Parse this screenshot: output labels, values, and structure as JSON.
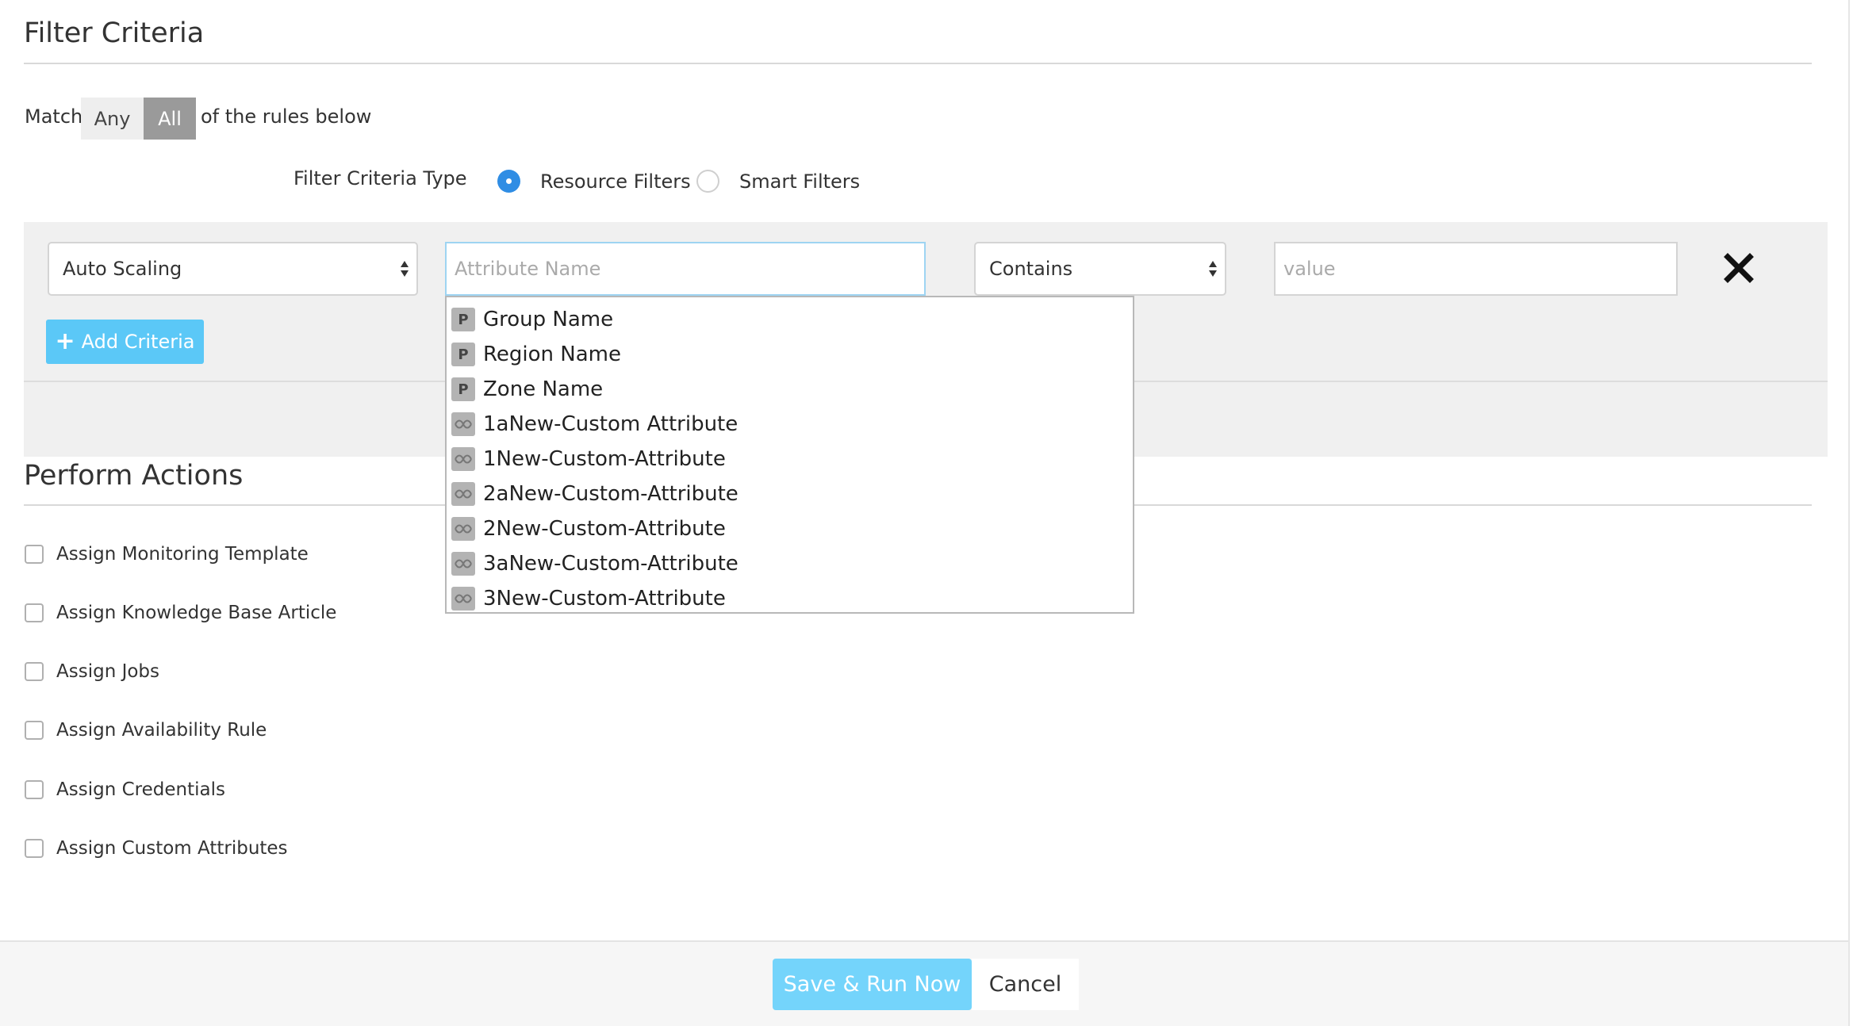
{
  "filter_criteria": {
    "title": "Filter Criteria",
    "match_label": "Match",
    "match_options": [
      "Any",
      "All"
    ],
    "match_selected": "All",
    "rules_suffix": "of the rules below",
    "type_label": "Filter Criteria Type",
    "type_options": [
      "Resource Filters",
      "Smart Filters"
    ],
    "type_selected": "Resource Filters"
  },
  "criteria_row": {
    "resource_type": "Auto Scaling",
    "attribute_placeholder": "Attribute Name",
    "operator": "Contains",
    "value_placeholder": "value",
    "remove_icon": "close-icon"
  },
  "add_criteria_label": "Add Criteria",
  "attribute_dropdown": {
    "items": [
      {
        "badge": "P",
        "label": "Group Name",
        "kind": "property"
      },
      {
        "badge": "P",
        "label": "Region Name",
        "kind": "property"
      },
      {
        "badge": "P",
        "label": "Zone Name",
        "kind": "property"
      },
      {
        "badge": "",
        "label": "1aNew-Custom Attribute",
        "kind": "custom-attribute-icon"
      },
      {
        "badge": "",
        "label": "1New-Custom-Attribute",
        "kind": "custom-attribute-icon"
      },
      {
        "badge": "",
        "label": "2aNew-Custom-Attribute",
        "kind": "custom-attribute-icon"
      },
      {
        "badge": "",
        "label": "2New-Custom-Attribute",
        "kind": "custom-attribute-icon"
      },
      {
        "badge": "",
        "label": "3aNew-Custom-Attribute",
        "kind": "custom-attribute-icon"
      },
      {
        "badge": "",
        "label": "3New-Custom-Attribute",
        "kind": "custom-attribute-icon"
      }
    ]
  },
  "perform_actions": {
    "title": "Perform Actions",
    "actions": [
      {
        "label": "Assign Monitoring Template",
        "checked": false
      },
      {
        "label": "Assign Knowledge Base Article",
        "checked": false
      },
      {
        "label": "Assign Jobs",
        "checked": false
      },
      {
        "label": "Assign Availability Rule",
        "checked": false
      },
      {
        "label": "Assign Credentials",
        "checked": false
      },
      {
        "label": "Assign Custom Attributes",
        "checked": false
      }
    ]
  },
  "footer": {
    "save_label": "Save & Run Now",
    "cancel_label": "Cancel"
  },
  "colors": {
    "accent": "#2f8de4",
    "add_button": "#5bc8f7",
    "save_button": "#74d4fb",
    "toggle_selected": "#9a9a9a"
  }
}
